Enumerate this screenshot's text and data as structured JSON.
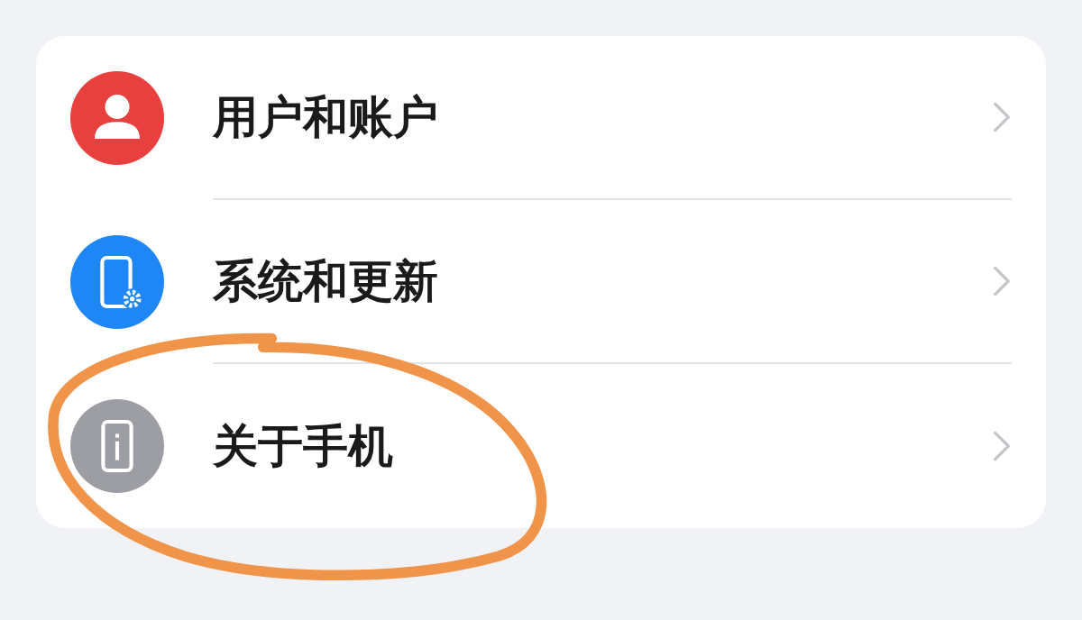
{
  "settings_list": [
    {
      "kind": "user",
      "label": "用户和账户",
      "color": "#e8403e",
      "circled": false
    },
    {
      "kind": "system",
      "label": "系统和更新",
      "color": "#1f87f5",
      "circled": false
    },
    {
      "kind": "about",
      "label": "关于手机",
      "color": "#9d9ea3",
      "circled": true
    }
  ]
}
